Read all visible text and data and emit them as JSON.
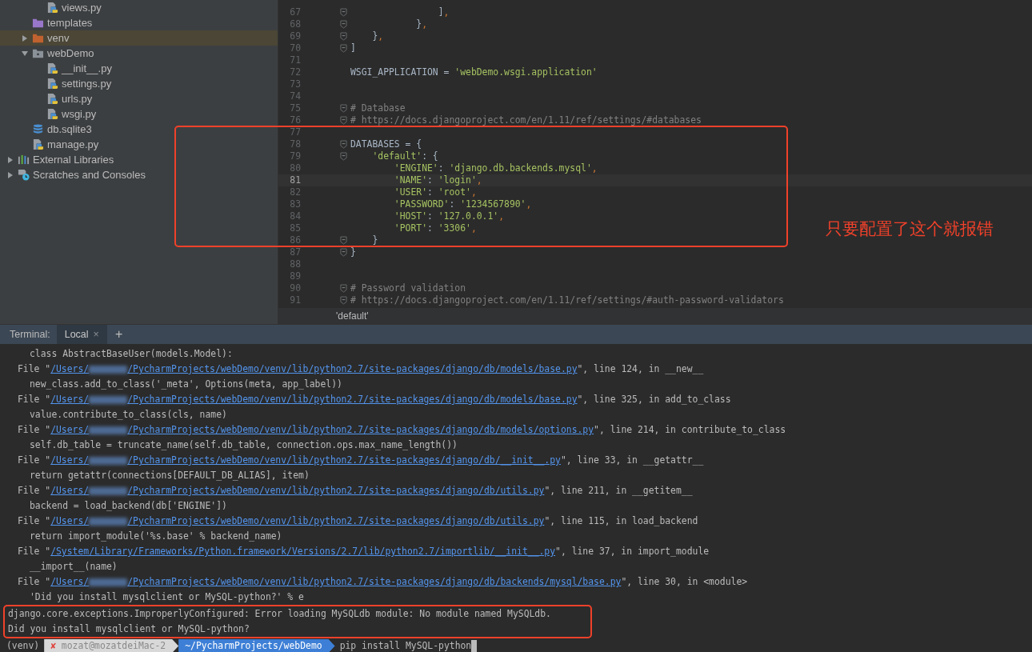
{
  "project_tree": [
    {
      "kind": "group",
      "children": [
        {
          "kind": "group",
          "children": [
            {
              "kind": "py",
              "label": "views.py"
            }
          ]
        },
        {
          "kind": "folder-templates",
          "label": "templates"
        },
        {
          "kind": "folder-excluded",
          "label": "venv",
          "expanded": false,
          "selected": true
        },
        {
          "kind": "package",
          "label": "webDemo",
          "expanded": true,
          "selected": false,
          "children": [
            {
              "kind": "py",
              "label": "__init__.py"
            },
            {
              "kind": "py",
              "label": "settings.py"
            },
            {
              "kind": "py",
              "label": "urls.py"
            },
            {
              "kind": "py",
              "label": "wsgi.py"
            }
          ]
        },
        {
          "kind": "database",
          "label": "db.sqlite3"
        },
        {
          "kind": "py",
          "label": "manage.py"
        }
      ]
    },
    {
      "kind": "libraries",
      "label": "External Libraries",
      "expanded": false,
      "selected": false
    },
    {
      "kind": "scratches",
      "label": "Scratches and Consoles",
      "expanded": false,
      "selected": false
    }
  ],
  "editor": {
    "lines": [
      {
        "number": "67",
        "fold": true,
        "current": false,
        "tokens": [
          {
            "t": "                ]",
            "kind": "plain"
          },
          {
            "t": ",",
            "kind": "punct"
          }
        ]
      },
      {
        "number": "68",
        "fold": true,
        "current": false,
        "tokens": [
          {
            "t": "            }",
            "kind": "plain"
          },
          {
            "t": ",",
            "kind": "punct"
          }
        ]
      },
      {
        "number": "69",
        "fold": true,
        "current": false,
        "tokens": [
          {
            "t": "    }",
            "kind": "plain"
          },
          {
            "t": ",",
            "kind": "punct"
          }
        ]
      },
      {
        "number": "70",
        "fold": true,
        "current": false,
        "tokens": [
          {
            "t": "]",
            "kind": "plain"
          }
        ]
      },
      {
        "number": "71",
        "fold": false,
        "current": false
      },
      {
        "number": "72",
        "fold": false,
        "current": false,
        "tokens": [
          {
            "t": "WSGI_APPLICATION = ",
            "kind": "plain"
          },
          {
            "t": "'webDemo.wsgi.application'",
            "kind": "str"
          }
        ]
      },
      {
        "number": "73",
        "fold": false,
        "current": false
      },
      {
        "number": "74",
        "fold": false,
        "current": false
      },
      {
        "number": "75",
        "fold": true,
        "current": false,
        "tokens": [
          {
            "t": "# Database",
            "kind": "comment"
          }
        ]
      },
      {
        "number": "76",
        "fold": true,
        "current": false,
        "tokens": [
          {
            "t": "# https://docs.djangoproject.com/en/1.11/ref/settings/#databases",
            "kind": "comment"
          }
        ]
      },
      {
        "number": "77",
        "fold": false,
        "current": false
      },
      {
        "number": "78",
        "fold": true,
        "current": false,
        "tokens": [
          {
            "t": "DATABASES = {",
            "kind": "plain"
          }
        ]
      },
      {
        "number": "79",
        "fold": true,
        "current": false,
        "tokens": [
          {
            "t": "    'default'",
            "kind": "str"
          },
          {
            "t": ": {",
            "kind": "plain"
          }
        ]
      },
      {
        "number": "80",
        "fold": false,
        "current": false,
        "tokens": [
          {
            "t": "        'ENGINE'",
            "kind": "str"
          },
          {
            "t": ": ",
            "kind": "plain"
          },
          {
            "t": "'django.db.backends.mysql'",
            "kind": "str"
          },
          {
            "t": ",",
            "kind": "punct"
          }
        ]
      },
      {
        "number": "81",
        "fold": false,
        "current": true,
        "tokens": [
          {
            "t": "        'NAME'",
            "kind": "str"
          },
          {
            "t": ": ",
            "kind": "plain"
          },
          {
            "t": "'login'",
            "kind": "str"
          },
          {
            "t": ",",
            "kind": "punct"
          }
        ]
      },
      {
        "number": "82",
        "fold": false,
        "current": false,
        "tokens": [
          {
            "t": "        'USER'",
            "kind": "str"
          },
          {
            "t": ": ",
            "kind": "plain"
          },
          {
            "t": "'root'",
            "kind": "str"
          },
          {
            "t": ",",
            "kind": "punct"
          }
        ]
      },
      {
        "number": "83",
        "fold": false,
        "current": false,
        "tokens": [
          {
            "t": "        'PASSWORD'",
            "kind": "str"
          },
          {
            "t": ": ",
            "kind": "plain"
          },
          {
            "t": "'1234567890'",
            "kind": "str"
          },
          {
            "t": ",",
            "kind": "punct"
          }
        ]
      },
      {
        "number": "84",
        "fold": false,
        "current": false,
        "tokens": [
          {
            "t": "        'HOST'",
            "kind": "str"
          },
          {
            "t": ": ",
            "kind": "plain"
          },
          {
            "t": "'127.0.0.1'",
            "kind": "str"
          },
          {
            "t": ",",
            "kind": "punct"
          }
        ]
      },
      {
        "number": "85",
        "fold": false,
        "current": false,
        "tokens": [
          {
            "t": "        'PORT'",
            "kind": "str"
          },
          {
            "t": ": ",
            "kind": "plain"
          },
          {
            "t": "'3306'",
            "kind": "str"
          },
          {
            "t": ",",
            "kind": "punct"
          }
        ]
      },
      {
        "number": "86",
        "fold": true,
        "current": false,
        "tokens": [
          {
            "t": "    }",
            "kind": "plain"
          }
        ]
      },
      {
        "number": "87",
        "fold": true,
        "current": false,
        "tokens": [
          {
            "t": "}",
            "kind": "plain"
          }
        ]
      },
      {
        "number": "88",
        "fold": false,
        "current": false
      },
      {
        "number": "89",
        "fold": false,
        "current": false
      },
      {
        "number": "90",
        "fold": true,
        "current": false,
        "tokens": [
          {
            "t": "# Password validation",
            "kind": "comment"
          }
        ]
      },
      {
        "number": "91",
        "fold": true,
        "current": false,
        "tokens": [
          {
            "t": "# https://docs.djangoproject.com/en/1.11/ref/settings/#auth-password-validators",
            "kind": "comment"
          }
        ]
      }
    ],
    "breadcrumb": "'default'"
  },
  "annotation": {
    "text": "只要配置了这个就报错"
  },
  "terminal": {
    "label": "Terminal:",
    "tabs": [
      {
        "label": "Local",
        "selected": true,
        "close": "×"
      }
    ],
    "add": "+",
    "lines": [
      {
        "kind": "code",
        "text": "class AbstractBaseUser(models.Model):"
      },
      {
        "kind": "file",
        "prefix": "File \"",
        "blurred": true,
        "path_start": "/Users/",
        "path": "/PycharmProjects/webDemo/venv/lib/python2.7/site-packages/django/db/models/base.py",
        "suffix": "\", line 124, in __new__"
      },
      {
        "kind": "code",
        "text": "new_class.add_to_class('_meta', Options(meta, app_label))"
      },
      {
        "kind": "file",
        "prefix": "File \"",
        "blurred": true,
        "path_start": "/Users/",
        "path": "/PycharmProjects/webDemo/venv/lib/python2.7/site-packages/django/db/models/base.py",
        "suffix": "\", line 325, in add_to_class"
      },
      {
        "kind": "code",
        "text": "value.contribute_to_class(cls, name)"
      },
      {
        "kind": "file",
        "prefix": "File \"",
        "blurred": true,
        "path_start": "/Users/",
        "path": "/PycharmProjects/webDemo/venv/lib/python2.7/site-packages/django/db/models/options.py",
        "suffix": "\", line 214, in contribute_to_class"
      },
      {
        "kind": "code",
        "text": "self.db_table = truncate_name(self.db_table, connection.ops.max_name_length())"
      },
      {
        "kind": "file",
        "prefix": "File \"",
        "blurred": true,
        "path_start": "/Users/",
        "path": "/PycharmProjects/webDemo/venv/lib/python2.7/site-packages/django/db/__init__.py",
        "suffix": "\", line 33, in __getattr__"
      },
      {
        "kind": "code",
        "text": "return getattr(connections[DEFAULT_DB_ALIAS], item)"
      },
      {
        "kind": "file",
        "prefix": "File \"",
        "blurred": true,
        "path_start": "/Users/",
        "path": "/PycharmProjects/webDemo/venv/lib/python2.7/site-packages/django/db/utils.py",
        "suffix": "\", line 211, in __getitem__"
      },
      {
        "kind": "code",
        "text": "backend = load_backend(db['ENGINE'])"
      },
      {
        "kind": "file",
        "prefix": "File \"",
        "blurred": true,
        "path_start": "/Users/",
        "path": "/PycharmProjects/webDemo/venv/lib/python2.7/site-packages/django/db/utils.py",
        "suffix": "\", line 115, in load_backend"
      },
      {
        "kind": "code",
        "text": "return import_module('%s.base' % backend_name)"
      },
      {
        "kind": "file",
        "prefix": "File \"",
        "blurred": false,
        "path": "/System/Library/Frameworks/Python.framework/Versions/2.7/lib/python2.7/importlib/__init__.py",
        "suffix": "\", line 37, in import_module"
      },
      {
        "kind": "code",
        "text": "__import__(name)"
      },
      {
        "kind": "file",
        "prefix": "File \"",
        "blurred": true,
        "path_start": "/Users/",
        "path": "/PycharmProjects/webDemo/venv/lib/python2.7/site-packages/django/db/backends/mysql/base.py",
        "suffix": "\", line 30, in <module>"
      },
      {
        "kind": "code",
        "text": "'Did you install mysqlclient or MySQL-python?' % e"
      },
      {
        "kind": "error",
        "text": "django.core.exceptions.ImproperlyConfigured: Error loading MySQLdb module: No module named MySQLdb."
      },
      {
        "kind": "error",
        "text": "Did you install mysqlclient or MySQL-python?"
      },
      {
        "kind": "prompt",
        "env": "(venv)",
        "status": "✘",
        "user": "mozat@mozatdeiMac-2",
        "cwd": "~/PycharmProjects/webDemo",
        "command": "pip install MySQL-python"
      }
    ]
  }
}
